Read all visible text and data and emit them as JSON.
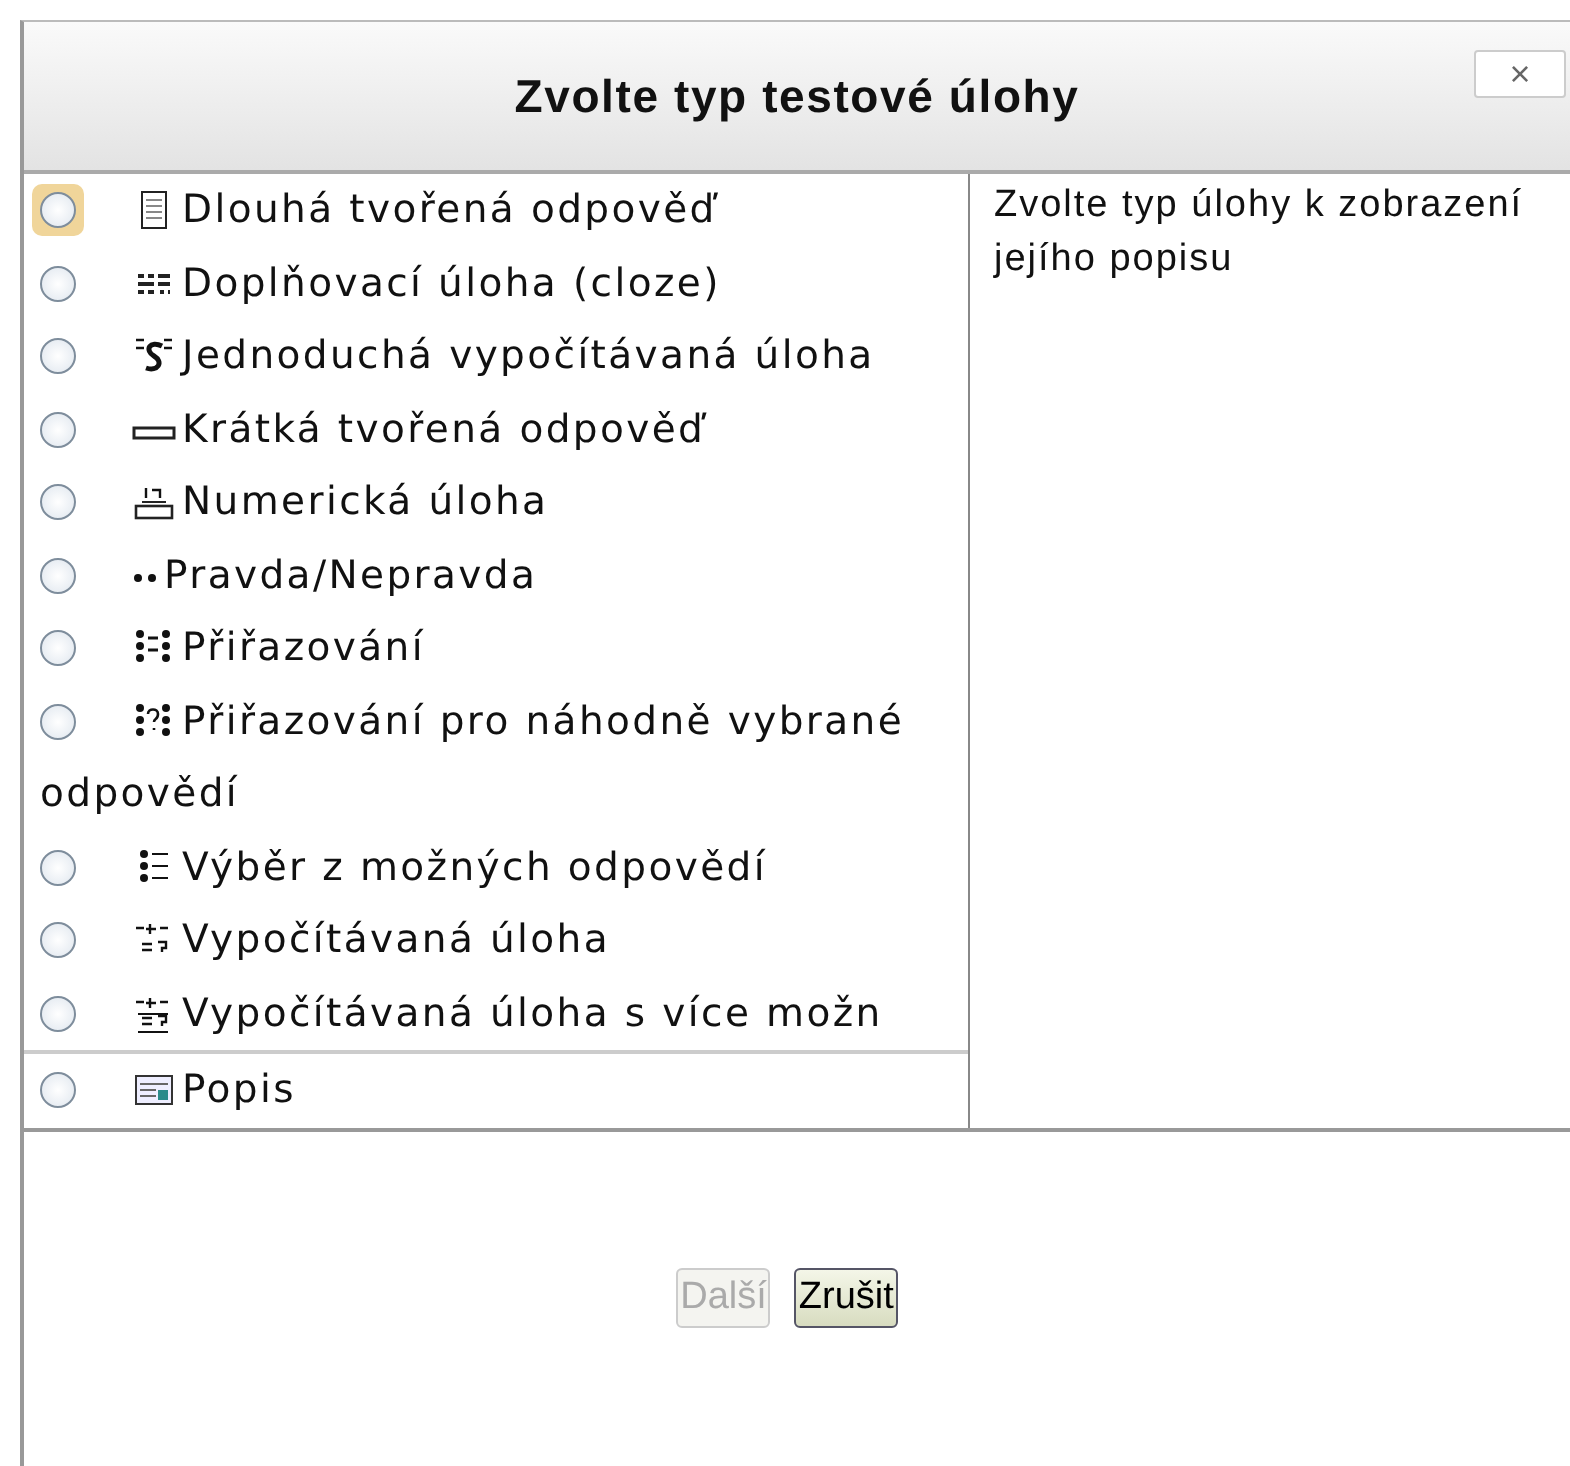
{
  "dialog": {
    "title": "Zvolte typ testové úlohy",
    "close": "×"
  },
  "question_types": [
    {
      "label": "Dlouhá tvořená odpověď",
      "kind": "essay",
      "selected": false,
      "focused": true
    },
    {
      "label": "Doplňovací úloha (cloze)",
      "kind": "cloze",
      "selected": false,
      "focused": false
    },
    {
      "label": "Jednoduchá vypočítávaná úloha",
      "kind": "calcsimple",
      "selected": false,
      "focused": false
    },
    {
      "label": "Krátká tvořená odpověď",
      "kind": "shortanswer",
      "selected": false,
      "focused": false
    },
    {
      "label": "Numerická úloha",
      "kind": "numerical",
      "selected": false,
      "focused": false
    },
    {
      "label": "Pravda/Nepravda",
      "kind": "truefalse",
      "selected": false,
      "focused": false
    },
    {
      "label": "Přiřazování",
      "kind": "match",
      "selected": false,
      "focused": false
    },
    {
      "label": "Přiřazování pro náhodně vybrané odpovědí",
      "kind": "randommatch",
      "selected": false,
      "focused": false
    },
    {
      "label": "Výběr z možných odpovědí",
      "kind": "multichoice",
      "selected": false,
      "focused": false
    },
    {
      "label": "Vypočítávaná úloha",
      "kind": "calculated",
      "selected": false,
      "focused": false
    },
    {
      "label": "Vypočítávaná úloha s více možn",
      "kind": "calcmulti",
      "selected": false,
      "focused": false
    }
  ],
  "other_types": [
    {
      "label": "Popis",
      "kind": "description",
      "selected": false,
      "focused": false
    }
  ],
  "description": "Zvolte typ úlohy k zobrazení jejího popisu",
  "buttons": [
    {
      "label": "Další",
      "disabled": true
    },
    {
      "label": "Zrušit",
      "disabled": false
    }
  ]
}
